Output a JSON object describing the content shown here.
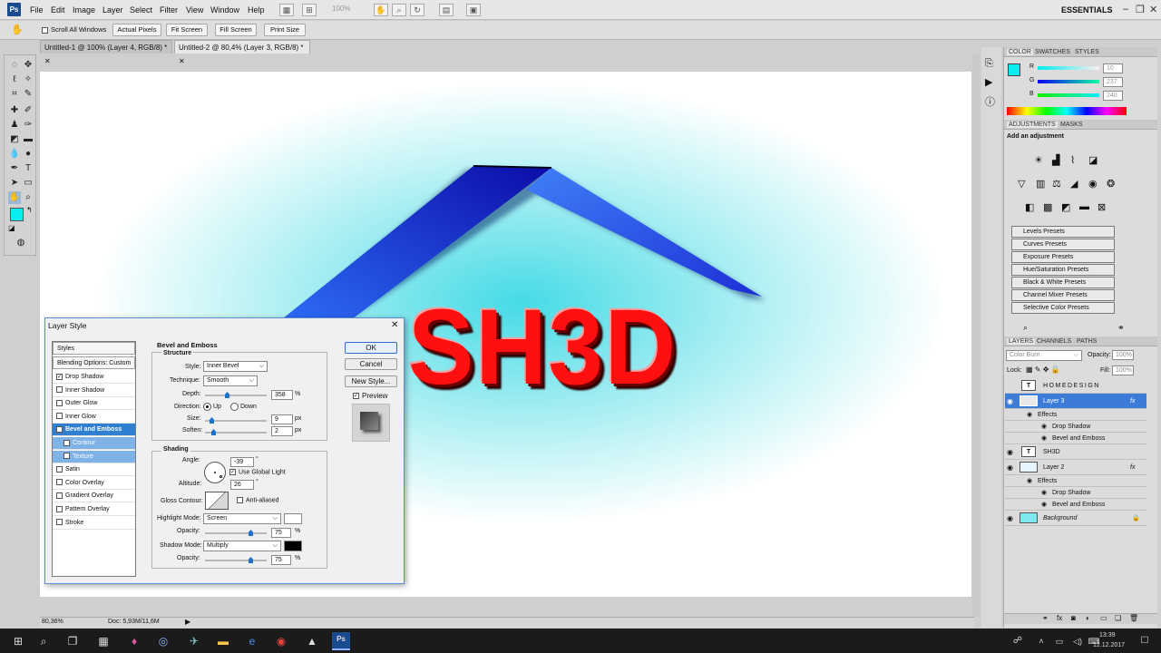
{
  "menubar": {
    "app_logo": "Ps",
    "items": [
      "File",
      "Edit",
      "Image",
      "Layer",
      "Select",
      "Filter",
      "View",
      "Window",
      "Help"
    ],
    "zoom_field": "100%",
    "workspace": "ESSENTIALS"
  },
  "options_bar": {
    "scroll_all_windows": "Scroll All Windows",
    "actual_pixels": "Actual Pixels",
    "fit_screen": "Fit Screen",
    "fill_screen": "Fill Screen",
    "print_size": "Print Size"
  },
  "tabs": [
    {
      "label": "Untitled-1 @ 100% (Layer 4, RGB/8) *"
    },
    {
      "label": "Untitled-2 @ 80,4% (Layer 3, RGB/8) *"
    }
  ],
  "canvas": {
    "text": "SH3D",
    "colors": {
      "text_red": "#ff1010",
      "roof_blue": "#1e3fe0",
      "bg_cyan": "#45dbe6"
    }
  },
  "statusbar": {
    "zoom": "80,36%",
    "doc": "Doc: 5,93M/11,6M"
  },
  "color_panel": {
    "tabs": [
      "COLOR",
      "SWATCHES",
      "STYLES"
    ],
    "r": "10",
    "g": "237",
    "b": "240",
    "r_label": "R",
    "g_label": "G",
    "b_label": "B",
    "fg_color": "#0aedf0"
  },
  "adjustments_panel": {
    "tabs": [
      "ADJUSTMENTS",
      "MASKS"
    ],
    "heading": "Add an adjustment",
    "presets": [
      "Levels Presets",
      "Curves Presets",
      "Exposure Presets",
      "Hue/Saturation Presets",
      "Black & White Presets",
      "Channel Mixer Presets",
      "Selective Color Presets"
    ]
  },
  "layers_panel": {
    "tabs": [
      "LAYERS",
      "CHANNELS",
      "PATHS"
    ],
    "blend_mode": "Color Burn",
    "opacity_label": "Opacity:",
    "opacity": "100%",
    "lock_label": "Lock:",
    "fill_label": "Fill:",
    "fill": "100%",
    "layers": [
      {
        "name": "HOMEDESIGN",
        "type": "text"
      },
      {
        "name": "Layer 3",
        "type": "image",
        "selected": true,
        "fx": "fx"
      },
      {
        "name": "Effects",
        "type": "effect-head"
      },
      {
        "name": "Drop Shadow",
        "type": "effect"
      },
      {
        "name": "Bevel and Emboss",
        "type": "effect"
      },
      {
        "name": "SH3D",
        "type": "text"
      },
      {
        "name": "Layer 2",
        "type": "image",
        "fx": "fx"
      },
      {
        "name": "Effects",
        "type": "effect-head"
      },
      {
        "name": "Drop Shadow",
        "type": "effect"
      },
      {
        "name": "Bevel and Emboss",
        "type": "effect"
      },
      {
        "name": "Background",
        "type": "background"
      }
    ]
  },
  "dialog": {
    "title": "Layer Style",
    "close": "✕",
    "styles_list": [
      {
        "label": "Styles",
        "checkbox": false,
        "checked": false
      },
      {
        "label": "Blending Options: Custom",
        "checkbox": false,
        "checked": false
      },
      {
        "label": "Drop Shadow",
        "checkbox": true,
        "checked": true
      },
      {
        "label": "Inner Shadow",
        "checkbox": true,
        "checked": false
      },
      {
        "label": "Outer Glow",
        "checkbox": true,
        "checked": false
      },
      {
        "label": "Inner Glow",
        "checkbox": true,
        "checked": false
      },
      {
        "label": "Bevel and Emboss",
        "checkbox": true,
        "checked": true,
        "selected": true
      },
      {
        "label": "Contour",
        "checkbox": true,
        "checked": true,
        "sub": true
      },
      {
        "label": "Texture",
        "checkbox": true,
        "checked": false,
        "sub": true
      },
      {
        "label": "Satin",
        "checkbox": true,
        "checked": false
      },
      {
        "label": "Color Overlay",
        "checkbox": true,
        "checked": false
      },
      {
        "label": "Gradient Overlay",
        "checkbox": true,
        "checked": false
      },
      {
        "label": "Pattern Overlay",
        "checkbox": true,
        "checked": false
      },
      {
        "label": "Stroke",
        "checkbox": true,
        "checked": false
      }
    ],
    "section_title": "Bevel and Emboss",
    "structure": {
      "title": "Structure",
      "style_label": "Style:",
      "style": "Inner Bevel",
      "technique_label": "Technique:",
      "technique": "Smooth",
      "depth_label": "Depth:",
      "depth": "358",
      "depth_unit": "%",
      "direction_label": "Direction:",
      "up": "Up",
      "down": "Down",
      "size_label": "Size:",
      "size": "9",
      "size_unit": "px",
      "soften_label": "Soften:",
      "soften": "2",
      "soften_unit": "px"
    },
    "shading": {
      "title": "Shading",
      "angle_label": "Angle:",
      "angle": "-39",
      "angle_unit": "°",
      "use_global_light": "Use Global Light",
      "altitude_label": "Altitude:",
      "altitude": "26",
      "altitude_unit": "°",
      "gloss_contour_label": "Gloss Contour:",
      "anti_aliased": "Anti-aliased",
      "highlight_mode_label": "Highlight Mode:",
      "highlight_mode": "Screen",
      "highlight_opacity_label": "Opacity:",
      "highlight_opacity": "75",
      "highlight_unit": "%",
      "shadow_mode_label": "Shadow Mode:",
      "shadow_mode": "Multiply",
      "shadow_opacity_label": "Opacity:",
      "shadow_opacity": "75",
      "shadow_unit": "%",
      "highlight_color": "#ffffff",
      "shadow_color": "#000000"
    },
    "buttons": {
      "ok": "OK",
      "cancel": "Cancel",
      "new_style": "New Style...",
      "preview": "Preview"
    }
  },
  "taskbar": {
    "time": "13:39",
    "date": "12.12.2017"
  }
}
